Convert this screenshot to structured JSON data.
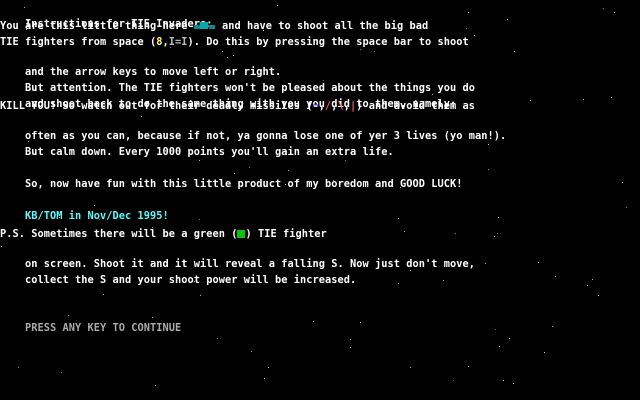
{
  "screen": {
    "background": "#000000",
    "text_color": "#ffffff",
    "accent_cyan": "#55ffff",
    "prompt_color": "#aaaaaa"
  },
  "instructions": {
    "title": "Instructions for TIE Invaders:",
    "line2_a": "You are this little thing here ",
    "line2_b": " and have to shoot all the big bad",
    "line3_a": "TIE fighters from space (",
    "line3_tie1": "8",
    "line3_sep": ",",
    "line3_tie2": "I=I",
    "line3_b": "). Do this by pressing the space bar to shoot",
    "line4": "and the arrow keys to move left or right.",
    "line5": "But attention. The TIE fighters won't be pleased about the things you do",
    "line6": "and shoot back to do the same thing with you you did to them, namely:",
    "line7_a": "KILL YOU! So watch out for their deadly missiles (",
    "line7_m1": "¬",
    "line7_m2": "/",
    "line7_m3": "\\",
    "line7_m4": "|",
    "line7_b": ") and avoid them as",
    "line8": "often as you can, because if not, ya gonna lose one of yer 3 lives (yo man!).",
    "line9": "But calm down. Every 1000 points you'll gain an extra life.",
    "line10": "So, now have fun with this little product of my boredom and GOOD LUCK!",
    "credit": "KB/TOM in Nov/Dec 1995!",
    "ps1_a": "P.S. Sometimes there will be a green (",
    "ps1_b": ") TIE fighter",
    "ps2": "on screen. Shoot it and it will reveal a falling S. Now just don't move,",
    "ps3": "collect the S and your shoot power will be increased."
  },
  "prompt": {
    "label": "PRESS ANY KEY TO CONTINUE"
  },
  "icons": {
    "player_ship": "player-ship-icon",
    "green_tie": "green-tie-icon"
  }
}
